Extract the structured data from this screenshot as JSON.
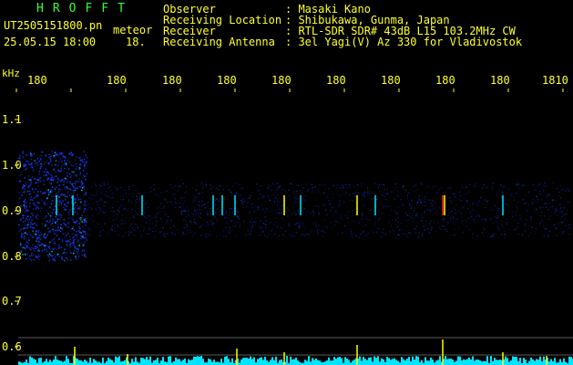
{
  "header": {
    "app_title": "HROFFT",
    "filename": "UT2505151800.pn",
    "mode": "meteor",
    "datetime": "25.05.15 18:00",
    "minute_label": "18.",
    "fields": [
      {
        "label": "Observer",
        "value": ": Masaki Kano"
      },
      {
        "label": "Receiving Location",
        "value": ": Shibukawa, Gunma, Japan"
      },
      {
        "label": "Receiver",
        "value": ": RTL-SDR SDR# 43dB L15 103.2MHz CW"
      },
      {
        "label": "Receiving Antenna",
        "value": ": 3el Yagi(V) Az 330 for Vladivostok"
      }
    ]
  },
  "axis": {
    "unit": "kHz",
    "time_ticks": [
      "180",
      "180",
      "180",
      "180",
      "180",
      "180",
      "180",
      "180",
      "180",
      "1810"
    ],
    "time_tick_suffix": [
      "",
      "",
      "",
      "",
      "",
      "",
      "",
      "",
      "",
      ""
    ],
    "y_ticks": [
      "1.1",
      "1.0",
      "0.9",
      "0.8",
      "0.7",
      "0.6"
    ]
  },
  "colors": {
    "text": "#ffff33",
    "title": "#33ff33",
    "grid": "#ffffff",
    "noise_blue": "#1a3cff",
    "signal_cyan": "#00e5ff",
    "spike_yellow": "#ffff00",
    "echo_red": "#ff2020"
  }
}
